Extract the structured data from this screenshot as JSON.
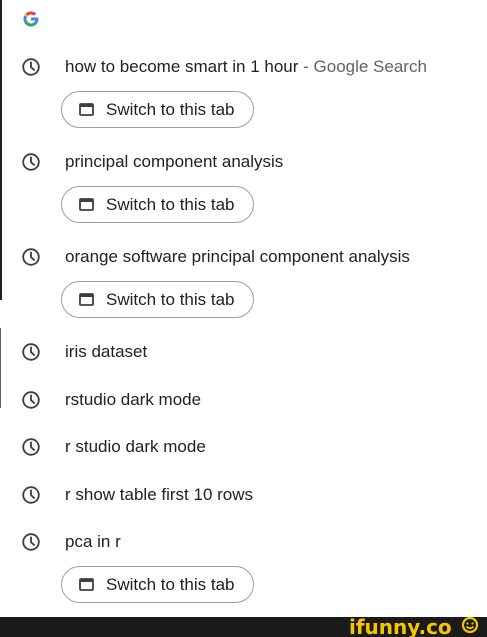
{
  "logo": {
    "letter": "G",
    "colors": {
      "blue": "#4285F4",
      "red": "#EA4335",
      "yellow": "#FBBC05",
      "green": "#34A853"
    }
  },
  "history": [
    {
      "text": "how to become smart in 1 hour",
      "separator": " - ",
      "suffix": "Google Search",
      "icon": "clock-icon"
    },
    {
      "text": "principal component analysis",
      "icon": "clock-icon"
    },
    {
      "text": "orange software principal component analysis",
      "icon": "clock-icon"
    },
    {
      "text": "iris dataset",
      "icon": "clock-icon"
    },
    {
      "text": "rstudio dark mode",
      "icon": "clock-icon"
    },
    {
      "text": "r studio dark mode",
      "icon": "clock-icon"
    },
    {
      "text": "r show table first 10 rows",
      "icon": "clock-icon"
    },
    {
      "text": "pca in r",
      "icon": "clock-icon"
    }
  ],
  "switch_tab": {
    "label": "Switch to this tab",
    "icon": "tab-icon"
  },
  "watermark": {
    "text": "ifunny.co",
    "color": "#f7c600"
  }
}
